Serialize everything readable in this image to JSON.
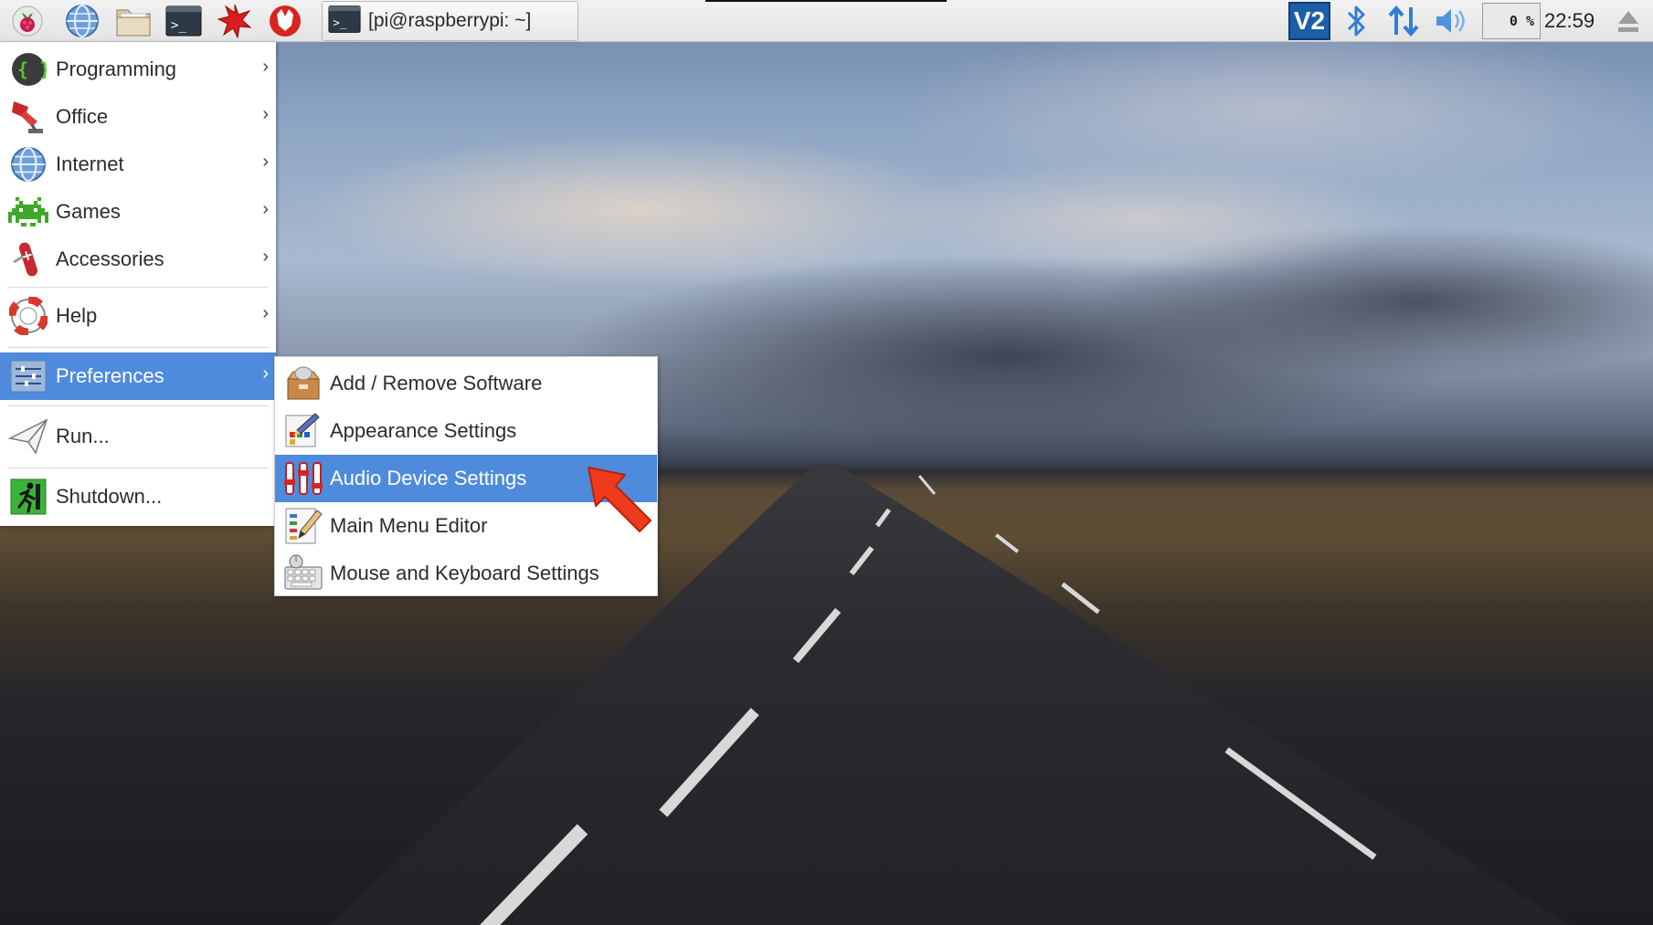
{
  "taskbar": {
    "launchers": [
      {
        "icon": "raspberry-menu-icon"
      },
      {
        "icon": "web-browser-icon"
      },
      {
        "icon": "file-manager-icon"
      },
      {
        "icon": "terminal-icon"
      },
      {
        "icon": "mathematica-icon"
      },
      {
        "icon": "wolfram-icon"
      }
    ],
    "window_button": {
      "icon": "terminal-icon",
      "label": "[pi@raspberrypi: ~]"
    },
    "tray": {
      "vnc_label": "V2",
      "bluetooth": "bluetooth-icon",
      "network": "network-arrows-icon",
      "volume": "volume-icon",
      "cpu_percent": "0 %",
      "clock": "22:59",
      "eject": "eject-icon"
    }
  },
  "main_menu": {
    "items": [
      {
        "label": "Programming",
        "icon": "programming-icon",
        "has_submenu": true
      },
      {
        "label": "Office",
        "icon": "office-icon",
        "has_submenu": true
      },
      {
        "label": "Internet",
        "icon": "internet-icon",
        "has_submenu": true
      },
      {
        "label": "Games",
        "icon": "games-icon",
        "has_submenu": true
      },
      {
        "label": "Accessories",
        "icon": "accessories-icon",
        "has_submenu": true
      },
      {
        "label": "Help",
        "icon": "help-icon",
        "has_submenu": true
      },
      {
        "label": "Preferences",
        "icon": "preferences-icon",
        "has_submenu": true,
        "active": true
      },
      {
        "label": "Run...",
        "icon": "run-icon",
        "has_submenu": false
      },
      {
        "label": "Shutdown...",
        "icon": "shutdown-icon",
        "has_submenu": false
      }
    ],
    "arrow_glyph": "›"
  },
  "preferences_menu": {
    "items": [
      {
        "label": "Add / Remove Software",
        "icon": "software-package-icon"
      },
      {
        "label": "Appearance Settings",
        "icon": "appearance-icon"
      },
      {
        "label": "Audio Device Settings",
        "icon": "audio-mixer-icon",
        "active": true
      },
      {
        "label": "Main Menu Editor",
        "icon": "menu-editor-icon"
      },
      {
        "label": "Mouse and Keyboard Settings",
        "icon": "keyboard-mouse-icon"
      }
    ]
  },
  "colors": {
    "highlight": "#4f8bdc",
    "annotation_arrow": "#ee3b1e",
    "vnc_blue": "#1c5fa8"
  }
}
